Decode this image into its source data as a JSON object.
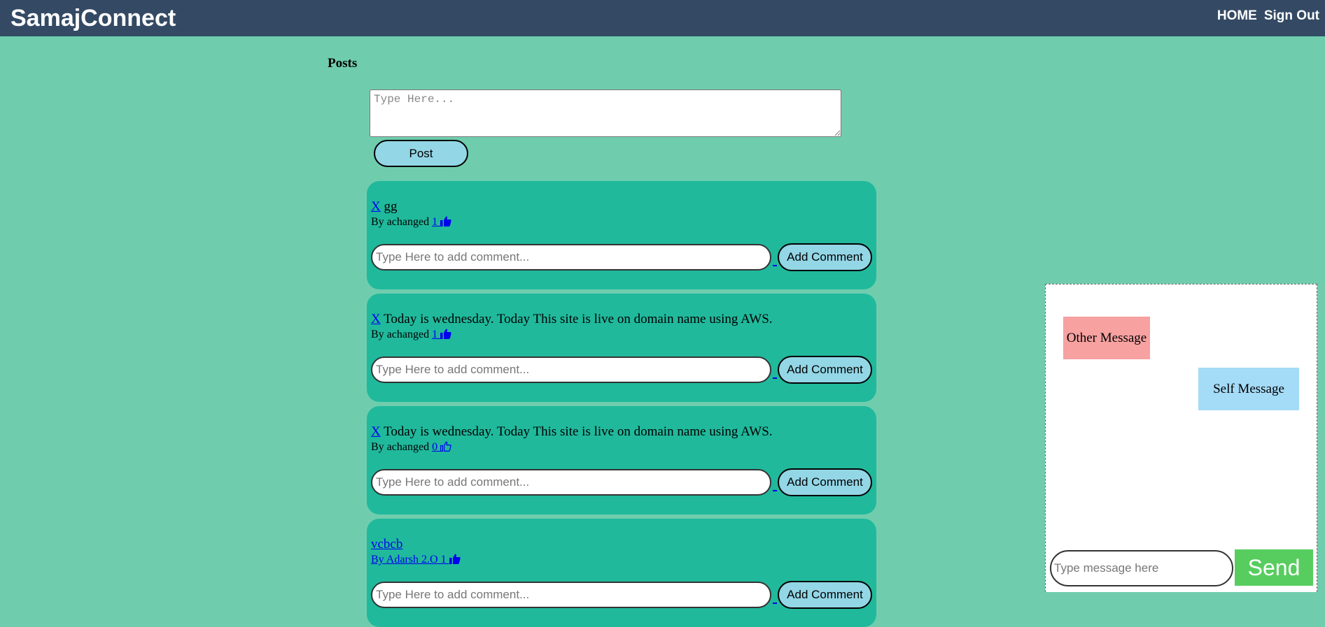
{
  "header": {
    "brand": "SamajConnect",
    "nav": [
      {
        "label": "HOME"
      },
      {
        "label": "Sign Out"
      }
    ]
  },
  "posts_section": {
    "title": "Posts",
    "input_placeholder": "Type Here...",
    "post_button": "Post"
  },
  "posts": [
    {
      "delete_label": "X",
      "text": "gg",
      "author_prefix": "By achanged",
      "likes": "1",
      "liked": true,
      "comment_placeholder": "Type Here to add comment...",
      "comment_button": "Add Comment"
    },
    {
      "delete_label": "X",
      "text": "Today is wednesday. Today This site is live on domain name using AWS.",
      "author_prefix": "By achanged",
      "likes": "1",
      "liked": true,
      "comment_placeholder": "Type Here to add comment...",
      "comment_button": "Add Comment"
    },
    {
      "delete_label": "X",
      "text": "Today is wednesday. Today This site is live on domain name using AWS.",
      "author_prefix": "By achanged",
      "likes": "0",
      "liked": false,
      "comment_placeholder": "Type Here to add comment...",
      "comment_button": "Add Comment"
    },
    {
      "text": "vcbcb",
      "author_prefix": "By Adarsh 2.O",
      "likes": "1",
      "liked": true,
      "comment_placeholder": "Type Here to add comment...",
      "comment_button": "Add Comment"
    }
  ],
  "chat": {
    "other_message": "Other Message",
    "self_message": "Self Message",
    "input_placeholder": "Type message here",
    "send_button": "Send"
  },
  "colors": {
    "background": "#6fcdae",
    "topbar": "#344a64",
    "post_card": "#20b99c",
    "button": "#93d6e6",
    "other_bubble": "#f7a1a1",
    "self_bubble": "#a4dbf7",
    "send": "#57cd5f",
    "link": "#0000ee"
  }
}
